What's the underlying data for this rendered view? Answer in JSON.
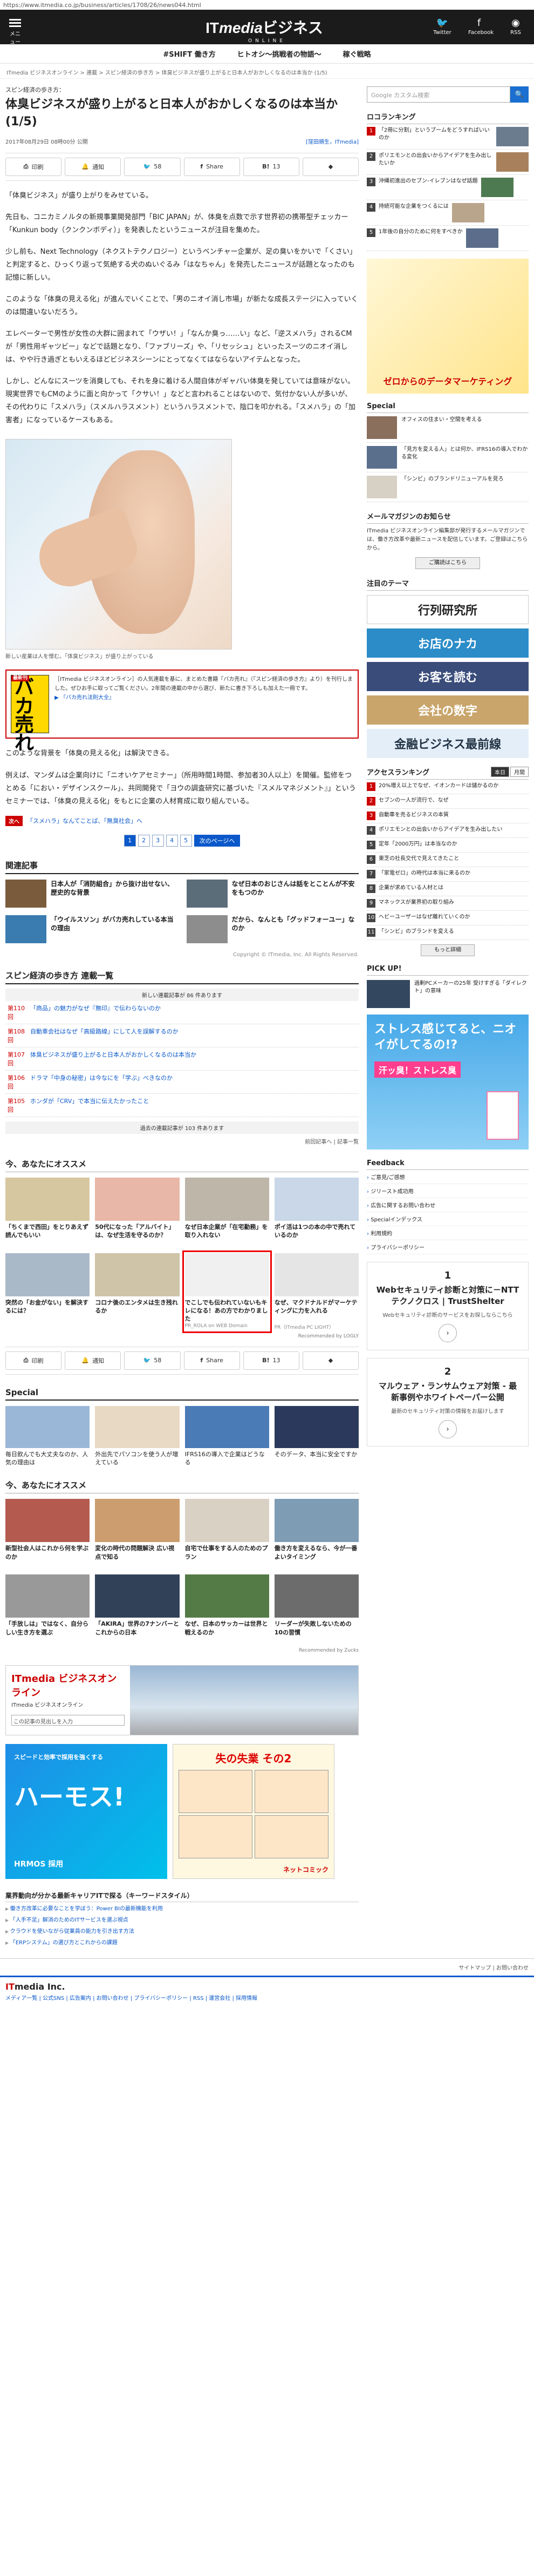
{
  "url": "https://www.itmedia.co.jp/business/articles/1708/26/news044.html",
  "header": {
    "menu_label": "メニュー",
    "logo_it": "IT",
    "logo_media": "media",
    "logo_business": "ビジネス",
    "logo_sub": "ONLINE",
    "twitter": "Twitter",
    "facebook": "Facebook",
    "rss": "RSS"
  },
  "topics": [
    "#SHIFT 働き方",
    "ヒトオシ～挑戦者の物語～",
    "稼ぐ戦略"
  ],
  "breadcrumb": "ITmedia ビジネスオンライン > 連載 > スピン経済の歩き方 > 体臭ビジネスが盛り上がると日本人がおかしくなるのは本当か (1/5)",
  "search_placeholder": "Google カスタム検索",
  "article": {
    "series": "スピン経済の歩き方：",
    "title": "体臭ビジネスが盛り上がると日本人がおかしくなるのは本当か (1/5)",
    "date": "2017年08月29日 08時00分 公開",
    "byline": "[窪田順生，ITmedia]",
    "share": {
      "print": "印刷",
      "notify": "通知",
      "tweet": "58",
      "fb": "Share",
      "hatena": "13",
      "pocket": ""
    },
    "paragraphs": [
      "「体臭ビジネス」が盛り上がりをみせている。",
      "先日も、コニカミノルタの新規事業開発部門「BIC JAPAN」が、体臭を点数で示す世界初の携帯型チェッカー「Kunkun body（クンクンボディ）」を発表したというニュースが注目を集めた。",
      "少し前も、Next Technology（ネクストテクノロジー）というベンチャー企業が、足の臭いをかいで「くさい」と判定すると、ひっくり返って気絶する犬のぬいぐるみ「はなちゃん」を発売したニュースが話題となったのも記憶に新しい。",
      "このような「体臭の見える化」が進んでいくことで、「男のニオイ消し市場」が新たな成長ステージに入っていくのは間違いないだろう。",
      "エレベーターで男性が女性の大群に囲まれて「ウザい！」「なんか臭っ……い」など、「逆スメハラ」されるCMが「男性用ギャツビー」などで話題となり、「ファブリーズ」や、「リセッシュ」といったスーツのニオイ消しは、やや行き過ぎともいえるほどビジネスシーンにとってなくてはならないアイテムとなった。",
      "しかし、どんなにスーツを消臭しても、それを身に着ける人間自体がギャバい体臭を発していては意味がない。現実世界でもCMのように面と向かって「クサい！」などと言われることはないので、気付かない人が多いが、その代わりに「スメハラ」（スメルハラスメント）というハラスメントで、陰口を叩かれる。「スメハラ」の「加害者」になっているケースもある。",
      "このような背景を「体臭の見える化」は解決できる。",
      "例えば、マンダムは企業向けに「ニオいケアセミナー」（所用時間1時間、参加者30人以上）を開催。監修をつとめる「におい・デザインスクール」、共同開発で「ヨウの調査研究に基づいた『スメルマネジメント』」というセミナーでは、「体臭の見える化」をもとに企業の人材育成に取り組んでいる。"
    ],
    "photo_caption": "新しい産業は人を憎む。「体臭ビジネス」が盛り上がっている",
    "promo": {
      "badge": "最新刊",
      "book_title": "バカ売れ",
      "text": "［ITmedia ビジネスオンライン］の人気連載を基に、まとめた書籍『バカ売れ』（『スピン経済の歩き方』より）を刊行しました。ぜひお手に取ってご覧ください。2年間の連載の中から選び、新たに書き下ろしも加えた一冊です。",
      "link": "▶ 『バカ売れ法則大全』"
    },
    "next": {
      "tag": "次へ",
      "link": "「スメハラ」なんてことば、「無臭社会」へ"
    },
    "pages": [
      "1",
      "2",
      "3",
      "4",
      "5"
    ],
    "next_page": "次のページへ"
  },
  "related": {
    "title": "関連記事",
    "items": [
      {
        "t": "日本人が「消防組合」から抜け出せない、歴史的な背景",
        "c": "#7a5b3c"
      },
      {
        "t": "なぜ日本のおじさんは話をとことんが不安をもつのか",
        "c": "#5c6d7a"
      },
      {
        "t": "「ウイルスソン」がバカ売れしている本当の理由",
        "c": "#3a7bb0"
      },
      {
        "t": "だから、なんとも「グッドフォーユー」なのか",
        "c": "#8d8d8d"
      }
    ],
    "copyright": "Copyright © ITmedia, Inc. All Rights Reserved."
  },
  "series_list": {
    "title": "スピン経済の歩き方 連載一覧",
    "recent": "新しい連載記事が 86 件あります",
    "items": [
      {
        "n": "第110回",
        "t": "「商品」の魅力がなぜ『無印』で伝わらないのか"
      },
      {
        "n": "第108回",
        "t": "自動車会社はなぜ「高級路線」にして人を誤解するのか"
      },
      {
        "n": "第107回",
        "t": "体臭ビジネスが盛り上がると日本人がおかしくなるのは本当か"
      },
      {
        "n": "第106回",
        "t": "ドラマ「中身の秘密」は今なにを「学ぶ」べきなのか"
      },
      {
        "n": "第105回",
        "t": "ホンダが「CRV」で本当に伝えたかったこと"
      }
    ],
    "more": "過去の連載記事が 103 件あります",
    "back": "前回記事へ | 記事一覧"
  },
  "recommend": {
    "title": "今、あなたにオススメ",
    "items": [
      {
        "t": "「ちくまで西田」をとりあえず読んでもいい",
        "c": "#d7c7a0",
        "src": ""
      },
      {
        "t": "50代になった「アルバイト」は、なぜ生活を守るのか？",
        "c": "#e8b7a7",
        "src": ""
      },
      {
        "t": "なぜ日本企業が「在宅勤務」を取り入れない",
        "c": "#bdb6a9",
        "src": ""
      },
      {
        "t": "ポイ活は1つの本の中で売れているのか",
        "c": "#c9d7e8",
        "src": ""
      },
      {
        "t": "突然の「お金がない」を解決するには？",
        "c": "#aab9c7",
        "src": ""
      },
      {
        "t": "コロナ後のエンタメは生き残れるか",
        "c": "#cfc3a8",
        "src": ""
      },
      {
        "t": "でこしでも伝われていないもキレになる！あの方でわかりました",
        "c": "#f0f0f0",
        "src": "PR_ROLA on WEB Domain"
      },
      {
        "t": "なぜ、マクドナルドがマーケティングに力を入れる",
        "c": "#e5e5e5",
        "src": "PR（ITmedia PC LIGHT）"
      }
    ],
    "powered": "Recommended by LOGLY"
  },
  "special": {
    "title": "Special",
    "items": [
      {
        "t": "毎日飲んでも大丈夫なのか、人気の理由は",
        "c": "#9bb7d7"
      },
      {
        "t": "外出先でパソコンを使う人が増えている",
        "c": "#e8d9c4"
      },
      {
        "t": "IFRS16の導入で企業はどうなる",
        "c": "#4a7bb7"
      },
      {
        "t": "そのデータ、本当に安全ですか",
        "c": "#2b3a5c"
      }
    ]
  },
  "recommend2": {
    "title": "今、あなたにオススメ",
    "items": [
      {
        "t": "新型社会人はこれから何を学ぶのか",
        "c": "#b55a4f"
      },
      {
        "t": "変化の時代の問題解決 広い視点で知る",
        "c": "#cc9d6e"
      },
      {
        "t": "自宅で仕事をする人のためのプラン",
        "c": "#d9d1c4"
      },
      {
        "t": "働き方を変えるなら、今が一番よいタイミング",
        "c": "#7e9db5"
      },
      {
        "t": "「手放しは」ではなく、自分らしい生き方を選ぶ",
        "c": "#999"
      },
      {
        "t": "「AKIRA」世界の7ナンバーとこれからの日本",
        "c": "#314157"
      },
      {
        "t": "なぜ、日本のサッカーは世界と戦えるのか",
        "c": "#547a45"
      },
      {
        "t": "リーダーが失敗しないための10の習慣",
        "c": "#6c6c6c"
      }
    ],
    "powered": "Recommended by Zucks"
  },
  "banner_search": {
    "brand": "ITmedia ビジネスオンライン",
    "sub": "ITmedia ビジネスオンライン",
    "placeholder": "この記事の見出しを入力"
  },
  "harmos": {
    "small": "スピードと効率で採用を強くする",
    "big": "ハーモス!",
    "brand": "HRMOS 採用"
  },
  "comic": {
    "title": "失の失業 その2",
    "brand": "ネットコミック"
  },
  "links": {
    "title": "業界動向が分かる最新キャリアITで探る（キーワードスタイル）",
    "items": [
      "働き方改革に必要なことを学ぼう：Power BIの最新機能を利用",
      "「人手不足」解消のためのITサービスを選ぶ視点",
      "クラウドを使いながら従業員の能力を引き出す方法",
      "「ERPシステム」の選び方とこれからの課題"
    ]
  },
  "sidebar": {
    "ranking_title": "ロコランキング",
    "ranking": [
      "「2冊に分割」というブームをどうすればいいのか",
      "ポリエモンとの出会いからアイデアを生み出したいか",
      "沖縄初進出のセブン-イレブンはなぜ話題",
      "持続可能な企業をつくるには",
      "1年後の自分のために何をすべきか"
    ],
    "ad_line": "ゼロからのデータマーケティング",
    "special_title": "Special",
    "special": [
      "オフィスの住まい・空間を考える",
      "「見方を変える人」とは何か、IFRS16の導入でわかる変化",
      "「シンビ」のブランドリニューアルを見ろ"
    ],
    "mm_title": "メールマガジンのお知らせ",
    "mm_text": "ITmedia ビジネスオンライン編集部が発行するメールマガジンでは、働き方改革や最新ニュースを配信しています。ご登録はこちらから。",
    "mm_btn": "ご購読はこちら",
    "theme_title": "注目のテーマ",
    "themes": [
      {
        "t": "行列研究所",
        "bg": "#fff",
        "fg": "#222"
      },
      {
        "t": "お店のナカ",
        "bg": "#2b8cc8",
        "fg": "#fff"
      },
      {
        "t": "お客を読む",
        "bg": "#3a4c7a",
        "fg": "#fff"
      },
      {
        "t": "会社の数字",
        "bg": "#c9a56b",
        "fg": "#fff"
      },
      {
        "t": "金融ビジネス最前線",
        "bg": "#e3eef9",
        "fg": "#234"
      }
    ],
    "access_title": "アクセスランキング",
    "tabs": [
      "本日",
      "月間"
    ],
    "access": [
      "20%増え以上でなぜ、イオンカードは儲かるのか",
      "セブンの一人が流行で、なぜ",
      "自動車を売るビジネスの本質",
      "ポリエモンとの出会いからアイデアを生み出したい",
      "定年「2000万円」は本当なのか",
      "東芝の社長交代で見えてきたこと",
      "「家電ゼロ」の時代は本当に来るのか",
      "企業が求めている人材とは",
      "マネックスが業界初の取り組み",
      "ヘビーユーザーはなぜ離れていくのか",
      "「シンビ」のブランドを変える"
    ],
    "more": "もっと詳細",
    "pickup_title": "PICK UP!",
    "pickup": [
      "過剰PCメーカーの25年 受けすぎる「ダイレクト」の意味"
    ],
    "stress": {
      "t1": "ストレス感じてると、ニオイがしてるの!?",
      "t2": "汗ッ臭！ストレス臭"
    },
    "feedback_title": "Feedback",
    "feedback": [
      "ご意見/ご感想",
      "ジリースト成功用",
      "広告に関するお問い合わせ",
      "Specialインデックス",
      "利用規約",
      "プライバシーポリシー"
    ],
    "sponsored": [
      {
        "n": "1",
        "h": "Webセキュリティ診断と対策に－NTTテクノクロス | TrustShelter",
        "d": "Webセキュリティ診断のサービスをお探しならこちら"
      },
      {
        "n": "2",
        "h": "マルウェア・ランサムウェア対策 - 最新事例やホワイトペーパー公開",
        "d": "最新のセキュリティ対策の情報をお届けします"
      }
    ]
  },
  "footer": {
    "sitemap": "サイトマップ | お問い合わせ",
    "logo_it": "IT",
    "logo_rest": "media Inc.",
    "links": "メディア一覧 | 公式SNS | 広告案内 | お問い合わせ | プライバシーポリシー | RSS | 運営会社 | 採用情報"
  }
}
